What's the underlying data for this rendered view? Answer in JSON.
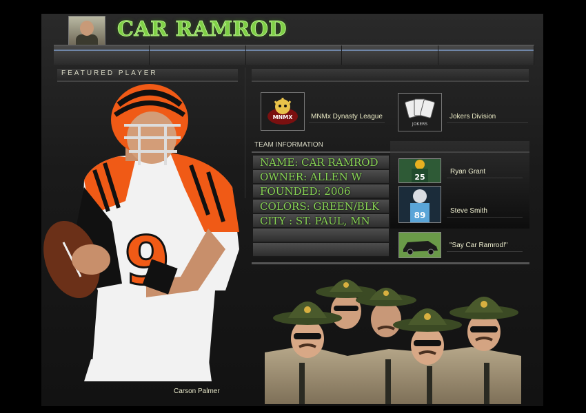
{
  "header": {
    "team_name": "CAR RAMROD",
    "avatar_icon": "trooper-avatar-icon"
  },
  "nav": {
    "tabs": [
      "",
      "",
      "",
      "",
      ""
    ]
  },
  "featured": {
    "label": "FEATURED PLAYER",
    "player_name": "Carson Palmer",
    "jersey_number": "9"
  },
  "league": {
    "name": "MNMx Dynasty League",
    "logo_text": "MNMX"
  },
  "division": {
    "name": "Jokers Division",
    "logo_text": "JOKERS"
  },
  "team_info": {
    "title": "TEAM INFORMATION",
    "rows": [
      "NAME: CAR RAMROD",
      "OWNER: ALLEN W",
      "FOUNDED: 2006",
      "COLORS: GREEN/BLK",
      "CITY : ST. PAUL, MN",
      ""
    ]
  },
  "players": [
    {
      "name": "Ryan Grant",
      "jersey": "25",
      "color": "#1f4a2c"
    },
    {
      "name": "Steve Smith",
      "jersey": "89",
      "color": "#5aa5d8"
    }
  ],
  "quote": "\"Say Car Ramrod!\"",
  "colors": {
    "accent_green": "#7fd046",
    "bengals_orange": "#f05a16"
  }
}
